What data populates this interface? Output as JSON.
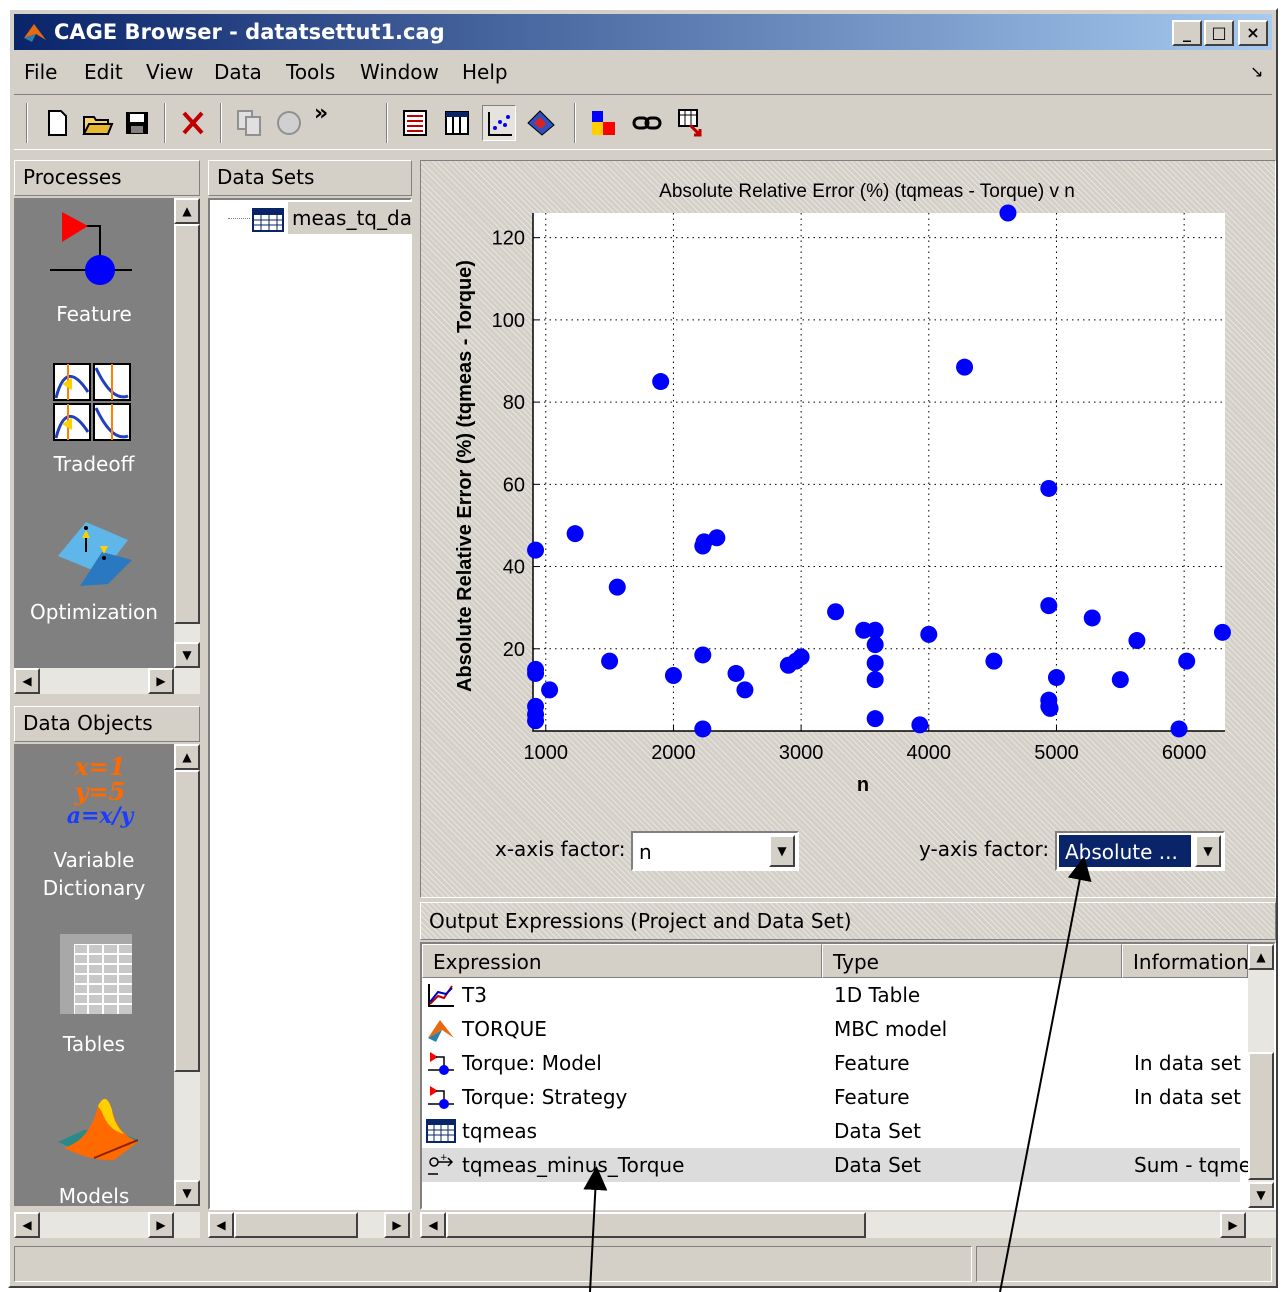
{
  "window": {
    "title": "CAGE Browser - datatsettut1.cag",
    "controls": [
      "_",
      "□",
      "×"
    ]
  },
  "menu": [
    "File",
    "Edit",
    "View",
    "Data",
    "Tools",
    "Window",
    "Help"
  ],
  "toolbar": {
    "icons": [
      "new-file-icon",
      "open-folder-icon",
      "save-icon",
      "delete-icon",
      "copy-icon",
      "paste-icon",
      "more-icon",
      "view-data-icon",
      "view-table-icon",
      "view-plot-icon",
      "view-color-icon",
      "factor-icon",
      "link-icon",
      "export-icon"
    ],
    "more_label": "»"
  },
  "processes": {
    "header": "Processes",
    "items": [
      {
        "label": "Feature",
        "icon": "feature-icon"
      },
      {
        "label": "Tradeoff",
        "icon": "tradeoff-icon"
      },
      {
        "label": "Optimization",
        "icon": "optimization-icon"
      }
    ]
  },
  "data_objects": {
    "header": "Data Objects",
    "items": [
      {
        "label": "Variable Dictionary",
        "icon": "variable-dictionary-icon",
        "glyph_lines": [
          "x=1",
          "y=5",
          "a=x/y"
        ]
      },
      {
        "label": "Tables",
        "icon": "tables-icon"
      },
      {
        "label": "Models",
        "icon": "models-icon"
      }
    ]
  },
  "data_sets": {
    "header": "Data Sets",
    "items": [
      {
        "label": "meas_tq_da",
        "icon": "dataset-icon"
      }
    ]
  },
  "chart_data": {
    "type": "scatter",
    "title": "Absolute Relative Error (%) (tqmeas - Torque) v n",
    "xlabel": "n",
    "ylabel": "Absolute Relative Error (%) (tqmeas - Torque)",
    "xlim": [
      900,
      6320
    ],
    "ylim": [
      0,
      126
    ],
    "xticks": [
      1000,
      2000,
      3000,
      4000,
      5000,
      6000
    ],
    "yticks": [
      20,
      40,
      60,
      80,
      100,
      120
    ],
    "grid": "dotted",
    "marker_color": "#0000ff",
    "points": [
      [
        920,
        44
      ],
      [
        920,
        15
      ],
      [
        920,
        14
      ],
      [
        920,
        6
      ],
      [
        920,
        4
      ],
      [
        920,
        2.5
      ],
      [
        1030,
        10
      ],
      [
        1230,
        48
      ],
      [
        1500,
        17
      ],
      [
        1560,
        35
      ],
      [
        1900,
        85
      ],
      [
        2000,
        13.5
      ],
      [
        2230,
        45
      ],
      [
        2240,
        46
      ],
      [
        2340,
        47
      ],
      [
        2230,
        18.5
      ],
      [
        2230,
        0.5
      ],
      [
        2490,
        14
      ],
      [
        2560,
        10
      ],
      [
        2900,
        16
      ],
      [
        2960,
        17
      ],
      [
        3000,
        18
      ],
      [
        3270,
        29
      ],
      [
        3490,
        24.5
      ],
      [
        3580,
        24.5
      ],
      [
        3580,
        21
      ],
      [
        3580,
        16.5
      ],
      [
        3580,
        12.5
      ],
      [
        3580,
        3
      ],
      [
        3930,
        1.5
      ],
      [
        4000,
        23.5
      ],
      [
        4280,
        88.5
      ],
      [
        4510,
        17
      ],
      [
        4620,
        126
      ],
      [
        4940,
        59
      ],
      [
        4940,
        30.5
      ],
      [
        4940,
        7.5
      ],
      [
        4940,
        6
      ],
      [
        4950,
        5.5
      ],
      [
        5000,
        13
      ],
      [
        5280,
        27.5
      ],
      [
        5500,
        12.5
      ],
      [
        5630,
        22
      ],
      [
        5960,
        0.5
      ],
      [
        6020,
        17
      ],
      [
        6300,
        24
      ]
    ]
  },
  "axis_factors": {
    "x_label": "x-axis factor:",
    "x_value": "n",
    "y_label": "y-axis factor:",
    "y_value": "Absolute ..."
  },
  "output_expressions": {
    "header": "Output Expressions (Project and Data Set)",
    "columns": [
      "Expression",
      "Type",
      "Information"
    ],
    "rows": [
      {
        "icon": "table-1d-icon",
        "expression": "T3",
        "type": "1D Table",
        "info": ""
      },
      {
        "icon": "mbc-model-icon",
        "expression": "TORQUE",
        "type": "MBC model",
        "info": ""
      },
      {
        "icon": "feature-small-icon",
        "expression": "Torque: Model",
        "type": "Feature",
        "info": "In data set"
      },
      {
        "icon": "feature-small-icon",
        "expression": "Torque: Strategy",
        "type": "Feature",
        "info": "In data set"
      },
      {
        "icon": "dataset-small-icon",
        "expression": "tqmeas",
        "type": "Data Set",
        "info": ""
      },
      {
        "icon": "expression-icon",
        "expression": "tqmeas_minus_Torque",
        "type": "Data Set",
        "info": "Sum - tqme"
      }
    ],
    "selected_row": 5
  },
  "colors": {
    "titlebar_start": "#0a246a",
    "titlebar_end": "#a6caf0",
    "selection": "#0a246a",
    "face": "#d4d0c8",
    "palette_bg": "#808080"
  }
}
